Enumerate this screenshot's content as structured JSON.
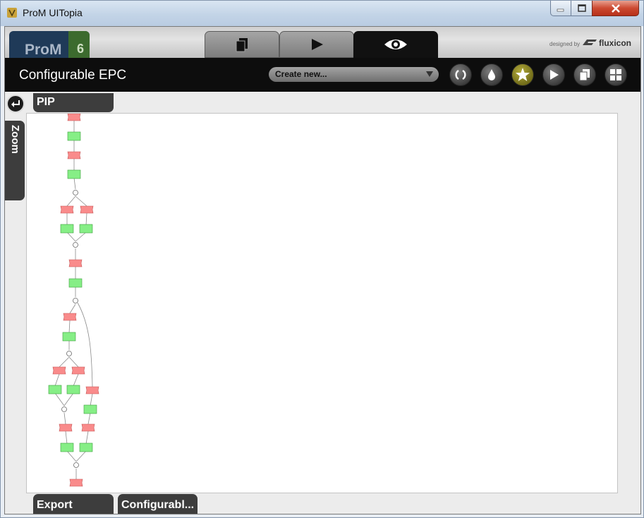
{
  "window": {
    "title": "ProM UITopia",
    "controls": [
      "minimize-icon",
      "maximize-icon",
      "close-icon"
    ]
  },
  "branding": {
    "logo_text": "ProM",
    "logo_version": "6",
    "designed_by": "designed by",
    "company": "fluxicon"
  },
  "perspective_tabs": [
    {
      "name": "workspace",
      "icon": "documents-icon"
    },
    {
      "name": "actions",
      "icon": "play-icon"
    },
    {
      "name": "view",
      "icon": "eye-icon",
      "active": true
    }
  ],
  "header": {
    "title": "Configurable EPC",
    "create_new": "Create new...",
    "buttons": [
      "refresh-icon",
      "drop-icon",
      "favorite-star-icon",
      "play-icon",
      "copy-icon",
      "grid-icon"
    ]
  },
  "panels": {
    "pip": "PIP",
    "zoom": "Zoom",
    "export": "Export",
    "configurable": "Configurabl..."
  },
  "colors": {
    "event_fill": "#f98b8b",
    "function_fill": "#86ee86",
    "header_bg": "#0d0d0d",
    "star_accent": "#8f8a24"
  }
}
